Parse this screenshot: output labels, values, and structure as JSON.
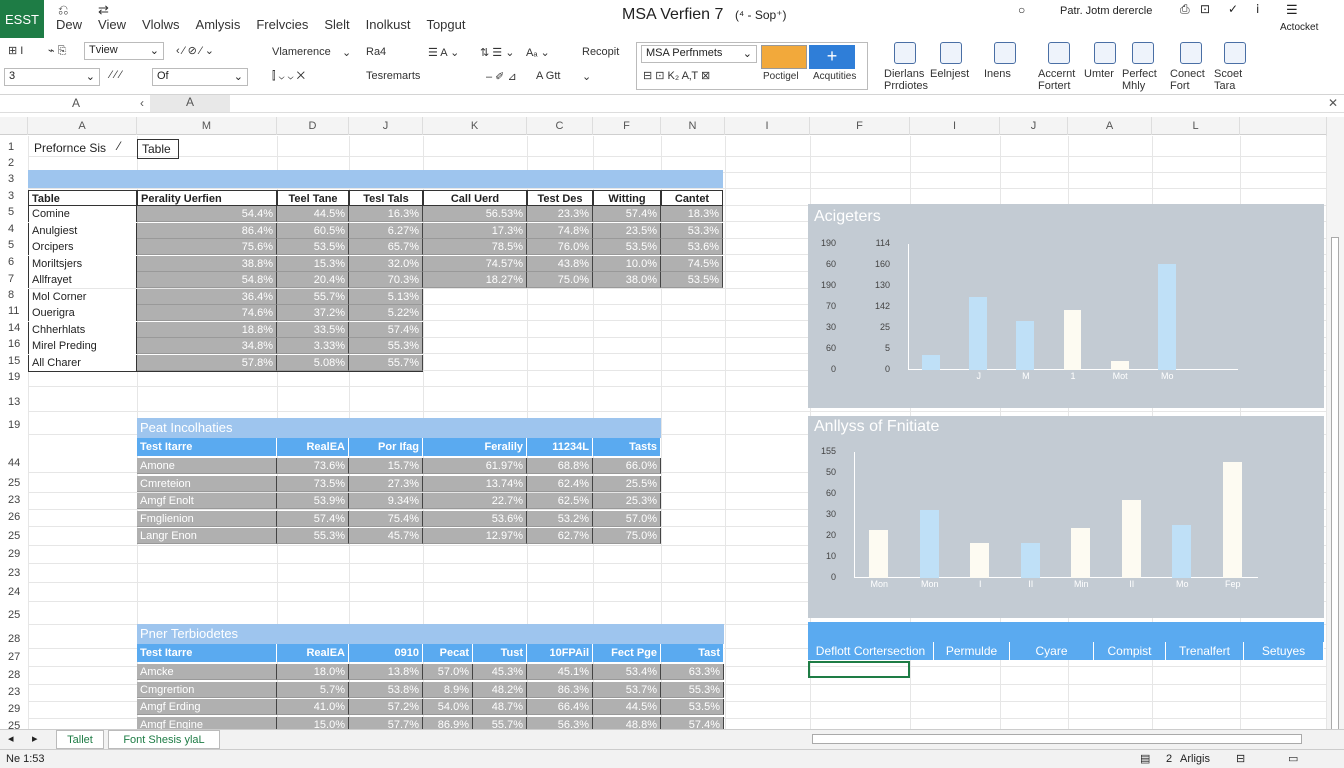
{
  "app": {
    "badge": "ESST",
    "title": "MSA Verfien 7",
    "title_suffix": "(⁴ - Sop⁺)",
    "user": "Patr. Jotm derercle",
    "right_label": "Actocket"
  },
  "menu": [
    "Dew",
    "View",
    "Vlolws",
    "Amlysis",
    "Frelvcies",
    "Slelt",
    "Inolkust",
    "Topgut"
  ],
  "ribbon": {
    "font_label": "Tview",
    "ref_box": "3",
    "field_box": "Of",
    "name_label": "Vlamerence",
    "size_label": "Ra4",
    "quick_label": "Tesremarts",
    "align_label": "A Gtt",
    "recopt": "Recopit",
    "style_box": "MSA Perfnmets",
    "style_caption_1": "Poctigel",
    "style_caption_2": "Acqutities",
    "groups": [
      {
        "top": "Dierlans",
        "bottom": "Prrdiotes"
      },
      {
        "top": "Eelnjest",
        "bottom": ""
      },
      {
        "top": "Inens",
        "bottom": ""
      },
      {
        "top": "Accernt",
        "bottom": "Fortert"
      },
      {
        "top": "Umter",
        "bottom": ""
      },
      {
        "top": "Perfect",
        "bottom": "Mhly"
      },
      {
        "top": "Conect",
        "bottom": "Fort"
      },
      {
        "top": "Scoet",
        "bottom": "Tara"
      }
    ]
  },
  "formula": {
    "name": "A",
    "value": "A"
  },
  "columns": [
    "A",
    "M",
    "D",
    "J",
    "K",
    "C",
    "F",
    "N",
    "I",
    "F",
    "I",
    "J",
    "A",
    "L"
  ],
  "row_numbers": [
    "1",
    "2",
    "3",
    "3",
    "5",
    "4",
    "5",
    "6",
    "7",
    "8",
    "11",
    "14",
    "16",
    "15",
    "19",
    "13",
    "19",
    "44",
    "25",
    "23",
    "26",
    "25",
    "29",
    "23",
    "24",
    "25",
    "28",
    "27",
    "28",
    "23",
    "29",
    "25"
  ],
  "top": {
    "title": "Prefornce Sis",
    "table_label": "Table",
    "headers": [
      "Table",
      "Perality Uerfien",
      "Teel Tane",
      "Tesl Tals",
      "Call Uerd",
      "Test Des",
      "Witting",
      "Cantet"
    ],
    "rows": [
      {
        "name": "Comine",
        "v": [
          "54.4%",
          "44.5%",
          "16.3%",
          "56.53%",
          "23.3%",
          "57.4%",
          "18.3%"
        ]
      },
      {
        "name": "Anulgiest",
        "v": [
          "86.4%",
          "60.5%",
          "6.27%",
          "17.3%",
          "74.8%",
          "23.5%",
          "53.3%"
        ]
      },
      {
        "name": "Orcipers",
        "v": [
          "75.6%",
          "53.5%",
          "65.7%",
          "78.5%",
          "76.0%",
          "53.5%",
          "53.6%"
        ]
      },
      {
        "name": "Moriltsjers",
        "v": [
          "38.8%",
          "15.3%",
          "32.0%",
          "74.57%",
          "43.8%",
          "10.0%",
          "74.5%"
        ]
      },
      {
        "name": "Allfrayet",
        "v": [
          "54.8%",
          "20.4%",
          "70.3%",
          "18.27%",
          "75.0%",
          "38.0%",
          "53.5%"
        ]
      },
      {
        "name": "Mol Corner",
        "v": [
          "36.4%",
          "55.7%",
          "5.13%"
        ]
      },
      {
        "name": "Ouerigra",
        "v": [
          "74.6%",
          "37.2%",
          "5.22%"
        ]
      },
      {
        "name": "Chherhlats",
        "v": [
          "18.8%",
          "33.5%",
          "57.4%"
        ]
      },
      {
        "name": "Mirel Preding",
        "v": [
          "34.8%",
          "3.33%",
          "55.3%"
        ]
      },
      {
        "name": "All Charer",
        "v": [
          "57.8%",
          "5.08%",
          "55.7%"
        ]
      }
    ]
  },
  "mid": {
    "title": "Peat Incolhaties",
    "headers": [
      "Test Itarre",
      "RealEA",
      "Por Ifag",
      "Feralily",
      "11234L",
      "Tasts"
    ],
    "rows": [
      {
        "name": "Amone",
        "v": [
          "73.6%",
          "15.7%",
          "61.97%",
          "68.8%",
          "66.0%"
        ]
      },
      {
        "name": "Cmreteion",
        "v": [
          "73.5%",
          "27.3%",
          "13.74%",
          "62.4%",
          "25.5%"
        ]
      },
      {
        "name": "Amgf Enolt",
        "v": [
          "53.9%",
          "9.34%",
          "22.7%",
          "62.5%",
          "25.3%"
        ]
      },
      {
        "name": "Fmglienion",
        "v": [
          "57.4%",
          "75.4%",
          "53.6%",
          "53.2%",
          "57.0%"
        ]
      },
      {
        "name": "Langr Enon",
        "v": [
          "55.3%",
          "45.7%",
          "12.97%",
          "62.7%",
          "75.0%"
        ]
      }
    ]
  },
  "bottom": {
    "title": "Pner Terbiodetes",
    "headers": [
      "Test Itarre",
      "RealEA",
      "0910",
      "Pecat",
      "Tust",
      "10FPAil",
      "Fect Pge",
      "Tast"
    ],
    "rows": [
      {
        "name": "Amcke",
        "v": [
          "18.0%",
          "13.8%",
          "57.0%",
          "45.3%",
          "45.1%",
          "53.4%",
          "63.3%"
        ]
      },
      {
        "name": "Cmgrertion",
        "v": [
          "5.7%",
          "53.8%",
          "8.9%",
          "48.2%",
          "86.3%",
          "53.7%",
          "55.3%"
        ]
      },
      {
        "name": "Amgf Erding",
        "v": [
          "41.0%",
          "57.2%",
          "54.0%",
          "48.7%",
          "66.4%",
          "44.5%",
          "53.5%"
        ]
      },
      {
        "name": "Amgf Engine",
        "v": [
          "15.0%",
          "57.7%",
          "86.9%",
          "55.7%",
          "56.3%",
          "48.8%",
          "57.4%"
        ]
      }
    ]
  },
  "chart1": {
    "title": "Acigeters",
    "y1": [
      "190",
      "60",
      "190",
      "70",
      "30",
      "60",
      "0"
    ],
    "y2": [
      "114",
      "160",
      "130",
      "142",
      "25",
      "5",
      "0"
    ],
    "x": [
      "",
      "J",
      "M",
      "1",
      "Mot",
      "Mo"
    ],
    "values": [
      12,
      58,
      39,
      48,
      7,
      84,
      0
    ],
    "colors": [
      "#bfe0f7",
      "#bfe0f7",
      "#bfe0f7",
      "#fdfbf2",
      "#fdfbf2",
      "#bfe0f7"
    ]
  },
  "chart2": {
    "title": "Anllyss of Fnitiate",
    "y": [
      "155",
      "50",
      "60",
      "30",
      "20",
      "10",
      "0"
    ],
    "x": [
      "Mon",
      "Mon",
      "I",
      "II",
      "Min",
      "II",
      "Mo",
      "Fep"
    ],
    "values": [
      38,
      54,
      28,
      28,
      40,
      62,
      42,
      92
    ],
    "colors": [
      "#fdfbf2",
      "#bfe0f7",
      "#fdfbf2",
      "#bfe0f7",
      "#fdfbf2",
      "#fdfbf2",
      "#bfe0f7",
      "#fdfbf2"
    ]
  },
  "rtable": {
    "headers": [
      "Deflott Cortersection",
      "Permulde",
      "Cyare",
      "Compist",
      "Trenalfert",
      "Setuyes"
    ]
  },
  "sheets": [
    "Tallet",
    "Font Shesis ylaL"
  ],
  "status": {
    "left": "Ne 1:53",
    "right": "Arligis",
    "zoom": "2"
  }
}
